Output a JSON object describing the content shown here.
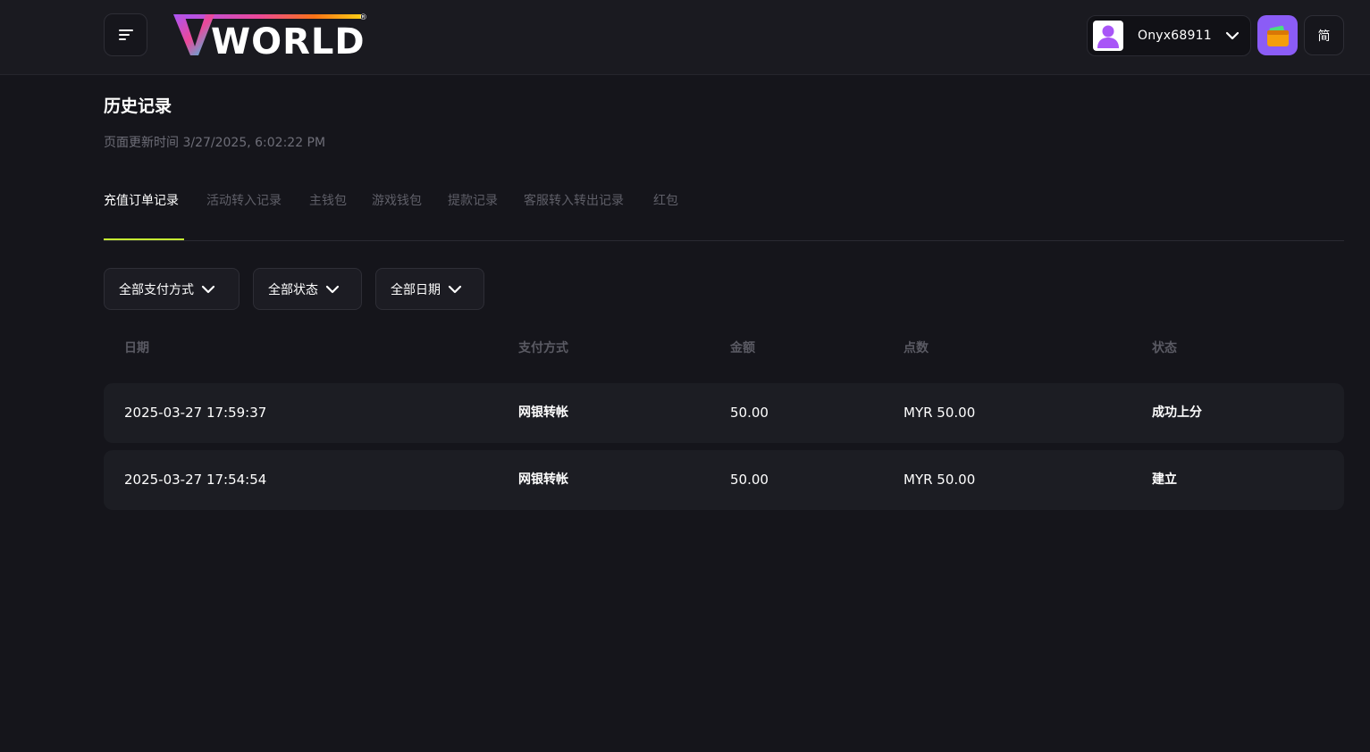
{
  "header": {
    "logo_text": "WORLD",
    "logo_mark": "V",
    "registered_mark": "®",
    "username": "Onyx68911",
    "language": "简",
    "icons": {
      "menu": "menu-icon",
      "user": "user-avatar-icon",
      "dropdown": "chevron-down-icon",
      "wallet": "wallet-icon"
    }
  },
  "page": {
    "title": "历史记录",
    "updated": "页面更新时间 3/27/2025, 6:02:22 PM"
  },
  "tabs": [
    {
      "label": "充值订单记录",
      "active": true
    },
    {
      "label": "活动转入记录",
      "active": false
    },
    {
      "label": "主钱包",
      "active": false
    },
    {
      "label": "游戏钱包",
      "active": false
    },
    {
      "label": "提款记录",
      "active": false
    },
    {
      "label": "客服转入转出记录",
      "active": false
    },
    {
      "label": "红包",
      "active": false
    }
  ],
  "filters": {
    "payment_method": "全部支付方式",
    "status": "全部状态",
    "date": "全部日期"
  },
  "table": {
    "headers": {
      "date": "日期",
      "method": "支付方式",
      "amount": "金额",
      "points": "点数",
      "status": "状态"
    },
    "rows": [
      {
        "date": "2025-03-27 17:59:37",
        "method": "网银转帐",
        "amount": "50.00",
        "points": "MYR 50.00",
        "status": "成功上分"
      },
      {
        "date": "2025-03-27 17:54:54",
        "method": "网银转帐",
        "amount": "50.00",
        "points": "MYR 50.00",
        "status": "建立"
      }
    ]
  },
  "colors": {
    "background": "#15151b",
    "header": "#1a1a20",
    "accent": "#c6f432",
    "wallet": "#8b5cf6",
    "row": "#1c1d23"
  }
}
